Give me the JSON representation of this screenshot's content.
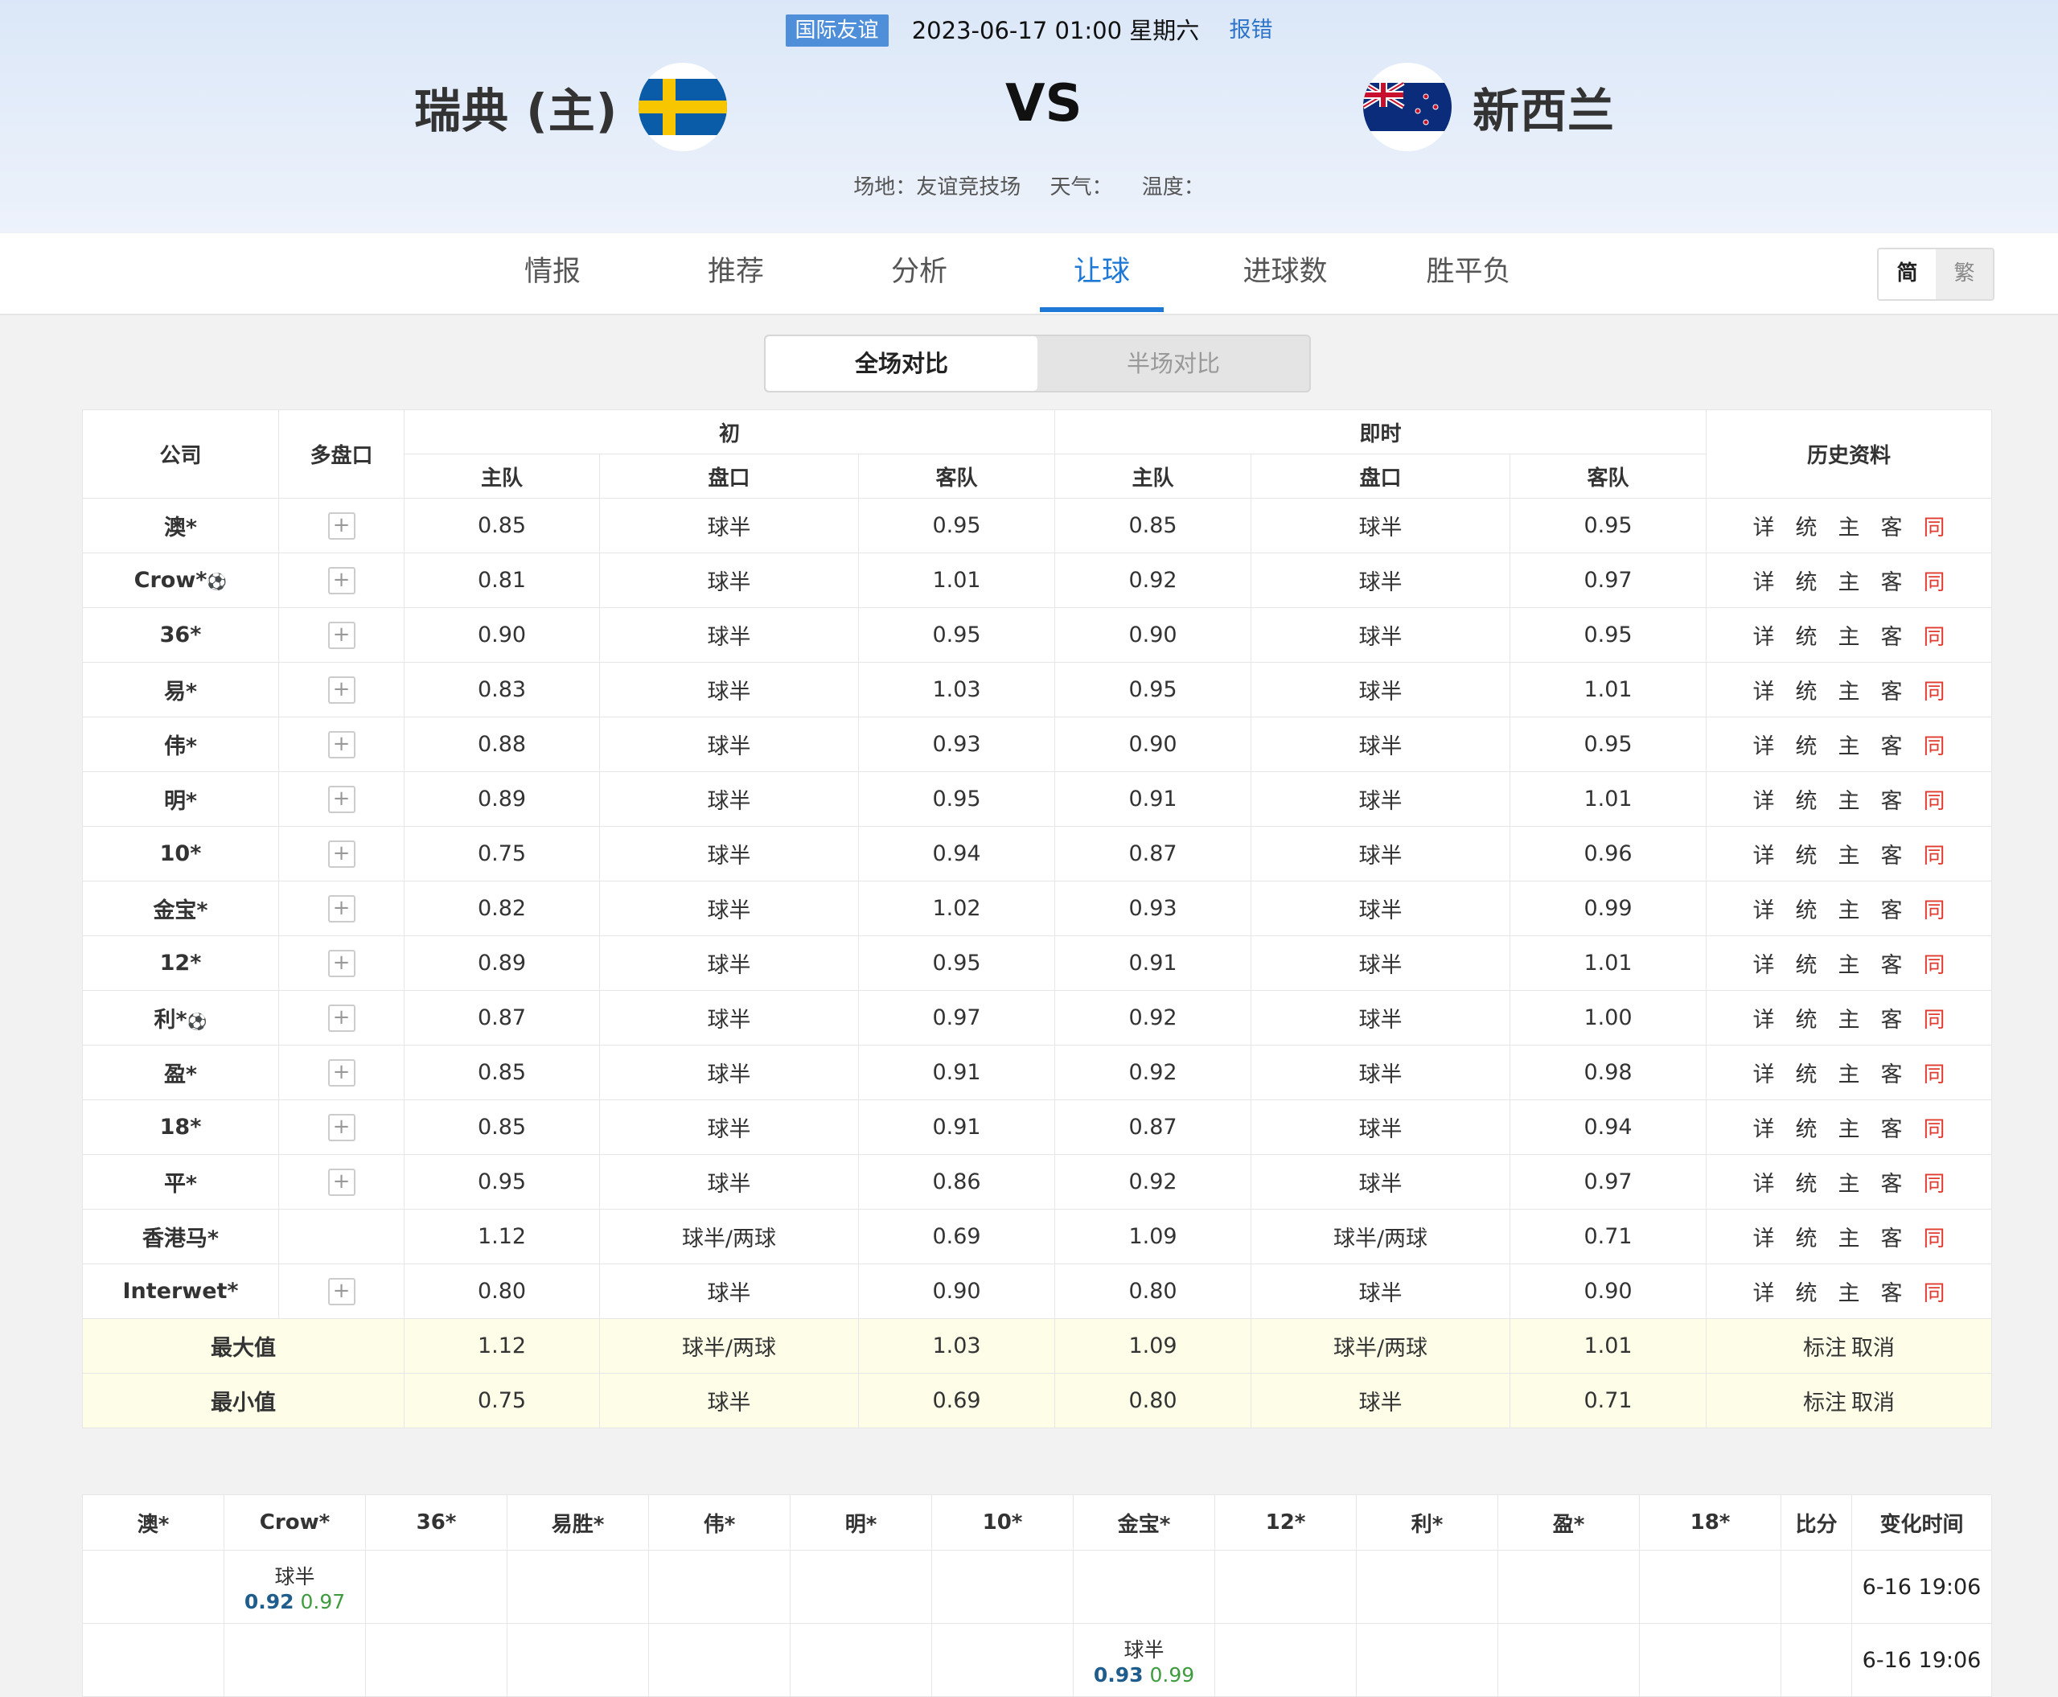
{
  "match": {
    "league": "国际友谊",
    "datetime": "2023-06-17 01:00 星期六",
    "report": "报错",
    "home": "瑞典 (主)",
    "away": "新西兰",
    "vs": "VS",
    "venue": "场地：友谊竞技场",
    "weather": "天气：",
    "temperature": "温度："
  },
  "tabs": [
    "情报",
    "推荐",
    "分析",
    "让球",
    "进球数",
    "胜平负"
  ],
  "active_tab": "让球",
  "lang": {
    "simplified": "简",
    "traditional": "繁"
  },
  "segment": {
    "full": "全场对比",
    "half": "半场对比"
  },
  "table_headers": {
    "company": "公司",
    "multi": "多盘口",
    "initial": "初",
    "live": "即时",
    "history": "历史资料",
    "home": "主队",
    "line": "盘口",
    "away": "客队"
  },
  "history_links": [
    "详",
    "统",
    "主",
    "客",
    "同"
  ],
  "rows": [
    {
      "company": "澳*",
      "ball": false,
      "plus": true,
      "i_home": "0.85",
      "i_line": "球半",
      "i_away": "0.95",
      "l_home": "0.85",
      "l_line": "球半",
      "l_away": "0.95"
    },
    {
      "company": "Crow*",
      "ball": true,
      "plus": true,
      "i_home": "0.81",
      "i_line": "球半",
      "i_away": "1.01",
      "l_home": "0.92",
      "l_line": "球半",
      "l_away": "0.97"
    },
    {
      "company": "36*",
      "ball": false,
      "plus": true,
      "i_home": "0.90",
      "i_line": "球半",
      "i_away": "0.95",
      "l_home": "0.90",
      "l_line": "球半",
      "l_away": "0.95"
    },
    {
      "company": "易*",
      "ball": false,
      "plus": true,
      "i_home": "0.83",
      "i_line": "球半",
      "i_away": "1.03",
      "l_home": "0.95",
      "l_line": "球半",
      "l_away": "1.01"
    },
    {
      "company": "伟*",
      "ball": false,
      "plus": true,
      "i_home": "0.88",
      "i_line": "球半",
      "i_away": "0.93",
      "l_home": "0.90",
      "l_line": "球半",
      "l_away": "0.95"
    },
    {
      "company": "明*",
      "ball": false,
      "plus": true,
      "i_home": "0.89",
      "i_line": "球半",
      "i_away": "0.95",
      "l_home": "0.91",
      "l_line": "球半",
      "l_away": "1.01"
    },
    {
      "company": "10*",
      "ball": false,
      "plus": true,
      "i_home": "0.75",
      "i_line": "球半",
      "i_away": "0.94",
      "l_home": "0.87",
      "l_line": "球半",
      "l_away": "0.96"
    },
    {
      "company": "金宝*",
      "ball": false,
      "plus": true,
      "i_home": "0.82",
      "i_line": "球半",
      "i_away": "1.02",
      "l_home": "0.93",
      "l_line": "球半",
      "l_away": "0.99"
    },
    {
      "company": "12*",
      "ball": false,
      "plus": true,
      "i_home": "0.89",
      "i_line": "球半",
      "i_away": "0.95",
      "l_home": "0.91",
      "l_line": "球半",
      "l_away": "1.01"
    },
    {
      "company": "利*",
      "ball": true,
      "plus": true,
      "i_home": "0.87",
      "i_line": "球半",
      "i_away": "0.97",
      "l_home": "0.92",
      "l_line": "球半",
      "l_away": "1.00"
    },
    {
      "company": "盈*",
      "ball": false,
      "plus": true,
      "i_home": "0.85",
      "i_line": "球半",
      "i_away": "0.91",
      "l_home": "0.92",
      "l_line": "球半",
      "l_away": "0.98"
    },
    {
      "company": "18*",
      "ball": false,
      "plus": true,
      "i_home": "0.85",
      "i_line": "球半",
      "i_away": "0.91",
      "l_home": "0.87",
      "l_line": "球半",
      "l_away": "0.94"
    },
    {
      "company": "平*",
      "ball": false,
      "plus": true,
      "i_home": "0.95",
      "i_line": "球半",
      "i_away": "0.86",
      "l_home": "0.92",
      "l_line": "球半",
      "l_away": "0.97"
    },
    {
      "company": "香港马*",
      "ball": false,
      "plus": false,
      "i_home": "1.12",
      "i_line": "球半/两球",
      "i_away": "0.69",
      "l_home": "1.09",
      "l_line": "球半/两球",
      "l_away": "0.71"
    },
    {
      "company": "Interwet*",
      "ball": false,
      "plus": true,
      "i_home": "0.80",
      "i_line": "球半",
      "i_away": "0.90",
      "l_home": "0.80",
      "l_line": "球半",
      "l_away": "0.90"
    }
  ],
  "summary": [
    {
      "label": "最大值",
      "i_home": "1.12",
      "i_line": "球半/两球",
      "i_away": "1.03",
      "l_home": "1.09",
      "l_line": "球半/两球",
      "l_away": "1.01",
      "mark": "标注",
      "cancel": "取消"
    },
    {
      "label": "最小值",
      "i_home": "0.75",
      "i_line": "球半",
      "i_away": "0.69",
      "l_home": "0.80",
      "l_line": "球半",
      "l_away": "0.71",
      "mark": "标注",
      "cancel": "取消"
    }
  ],
  "change_headers": [
    "澳*",
    "Crow*",
    "36*",
    "易胜*",
    "伟*",
    "明*",
    "10*",
    "金宝*",
    "12*",
    "利*",
    "盈*",
    "18*",
    "比分",
    "变化时间"
  ],
  "change_rows": [
    {
      "col": 1,
      "line": "球半",
      "home": "0.92",
      "away": "0.97",
      "time": "6-16 19:06"
    },
    {
      "col": 7,
      "line": "球半",
      "home": "0.93",
      "away": "0.99",
      "time": "6-16 19:06"
    }
  ],
  "colors": {
    "accent": "#1e78d6",
    "tag": "#4f8fda",
    "same_link": "#e03c31",
    "summary_bg": "#fdfde8"
  }
}
